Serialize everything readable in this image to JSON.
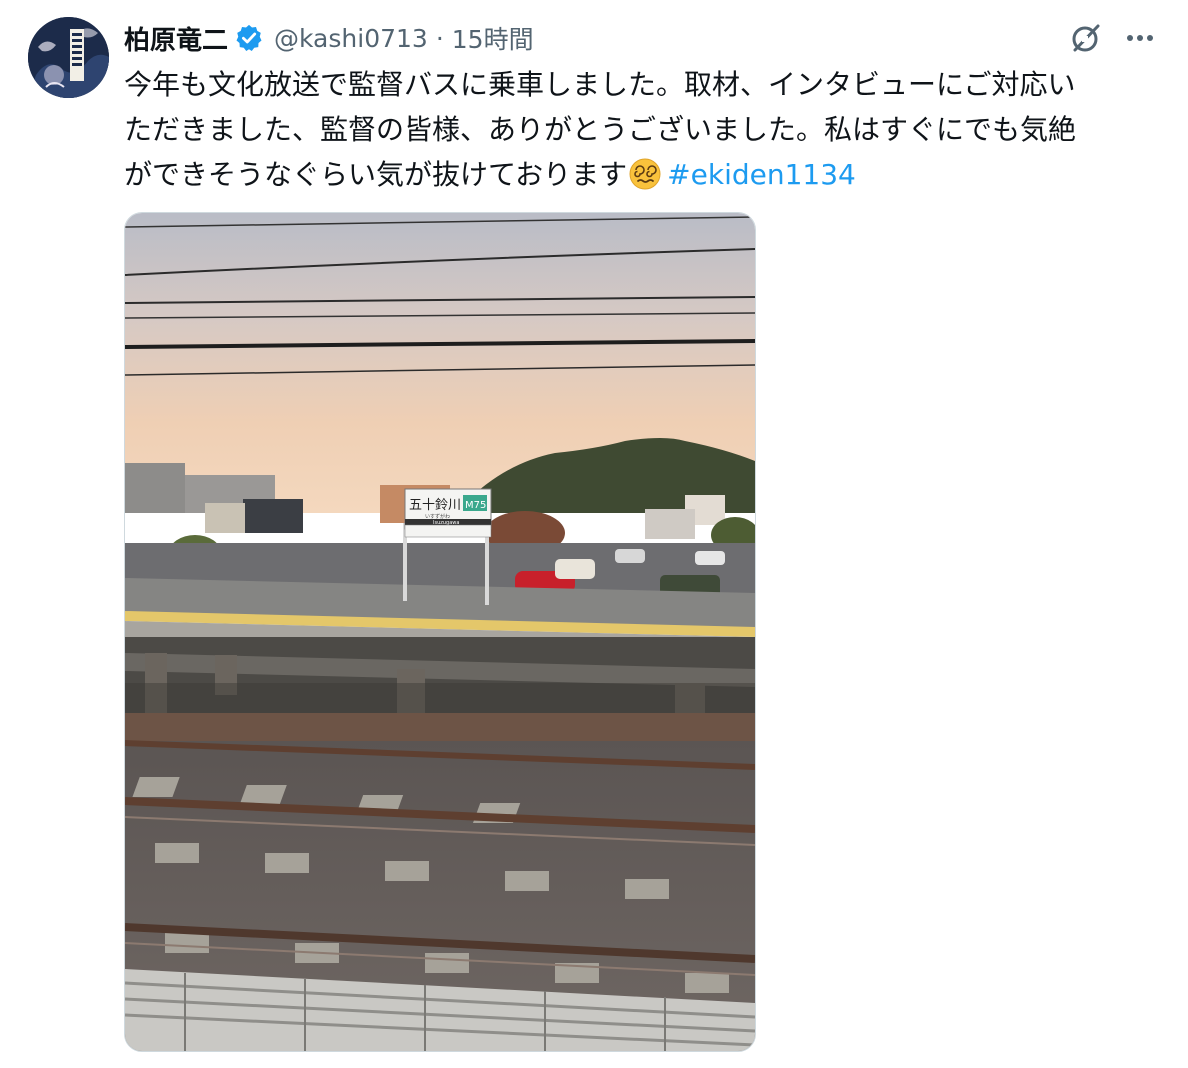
{
  "author": {
    "name": "柏原竜二",
    "handle": "@kashi0713",
    "separator": "·",
    "time": "15時間"
  },
  "icons": {
    "verified": "verified-badge-icon",
    "grok": "grok-icon",
    "more": "more-options-icon",
    "emoji": "face-with-spiral-eyes-emoji"
  },
  "tweet": {
    "line1": "今年も文化放送で監督バスに乗車しました。取材、インタビューにご対応い",
    "line2": "ただきました、監督の皆様、ありがとうございました。私はすぐにでも気絶",
    "line3": "ができそうなぐらい気が抜けております",
    "hashtag": "#ekiden1134"
  },
  "photo": {
    "station_sign": {
      "name": "五十鈴川",
      "number": "M75",
      "kana": "いすずがわ",
      "romaji": "Isuzugawa"
    }
  },
  "colors": {
    "link": "#1d9bf0",
    "verified": "#1d9bf0",
    "secondary_text": "#536471"
  }
}
